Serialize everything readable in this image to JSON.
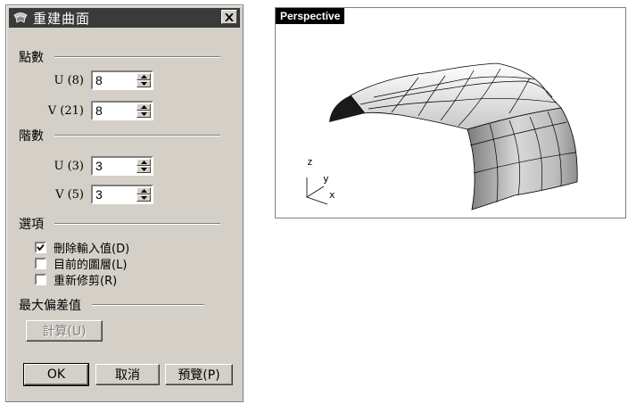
{
  "dialog": {
    "title": "重建曲面",
    "points_section": "點數",
    "points": [
      {
        "label": "U (8)",
        "value": "8"
      },
      {
        "label": "V (21)",
        "value": "8"
      }
    ],
    "degree_section": "階數",
    "degree": [
      {
        "label": "U (3)",
        "value": "3"
      },
      {
        "label": "V (5)",
        "value": "3"
      }
    ],
    "options_section": "選項",
    "options": [
      {
        "label": "刪除輸入值(D)",
        "checked": true
      },
      {
        "label": "目前的圖層(L)",
        "checked": false
      },
      {
        "label": "重新修剪(R)",
        "checked": false
      }
    ],
    "deviation_section": "最大偏差值",
    "calc_button": "計算(U)",
    "ok_button": "OK",
    "cancel_button": "取消",
    "preview_button": "預覽(P)"
  },
  "viewport": {
    "name": "Perspective",
    "axis_z": "z",
    "axis_y": "y",
    "axis_x": "x"
  }
}
